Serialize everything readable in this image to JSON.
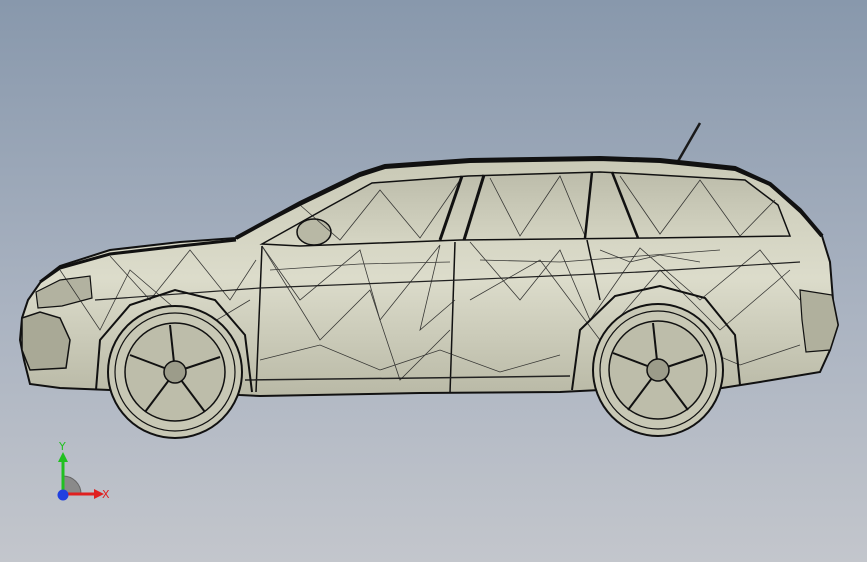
{
  "viewport": {
    "background_top": "#8898ac",
    "background_bottom": "#c3c6cc",
    "model_fill": "#d9d9c8",
    "edge_color": "#1a1a1a"
  },
  "triad": {
    "x_label": "X",
    "y_label": "Y",
    "x_color": "#e02020",
    "y_color": "#20c020",
    "z_color": "#2040e0"
  }
}
